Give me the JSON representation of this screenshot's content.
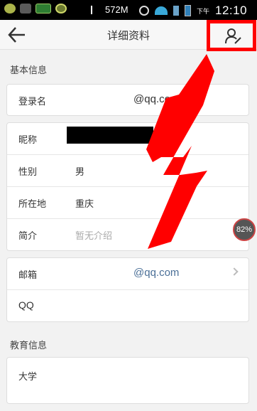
{
  "status_bar": {
    "network_speed": "572M",
    "time": "12:10",
    "am_pm": "下午"
  },
  "header": {
    "title": "详细资料"
  },
  "basic_info": {
    "section_title": "基本信息",
    "login_name_label": "登录名",
    "login_name_value": "@qq.com",
    "nickname_label": "昵称",
    "gender_label": "性别",
    "gender_value": "男",
    "location_label": "所在地",
    "location_value": "重庆",
    "intro_label": "简介",
    "intro_placeholder": "暂无介绍",
    "email_label": "邮箱",
    "email_value": "@qq.com",
    "qq_label": "QQ"
  },
  "education": {
    "section_title": "教育信息",
    "university_label": "大学"
  },
  "overlay": {
    "badge_text": "82%"
  }
}
